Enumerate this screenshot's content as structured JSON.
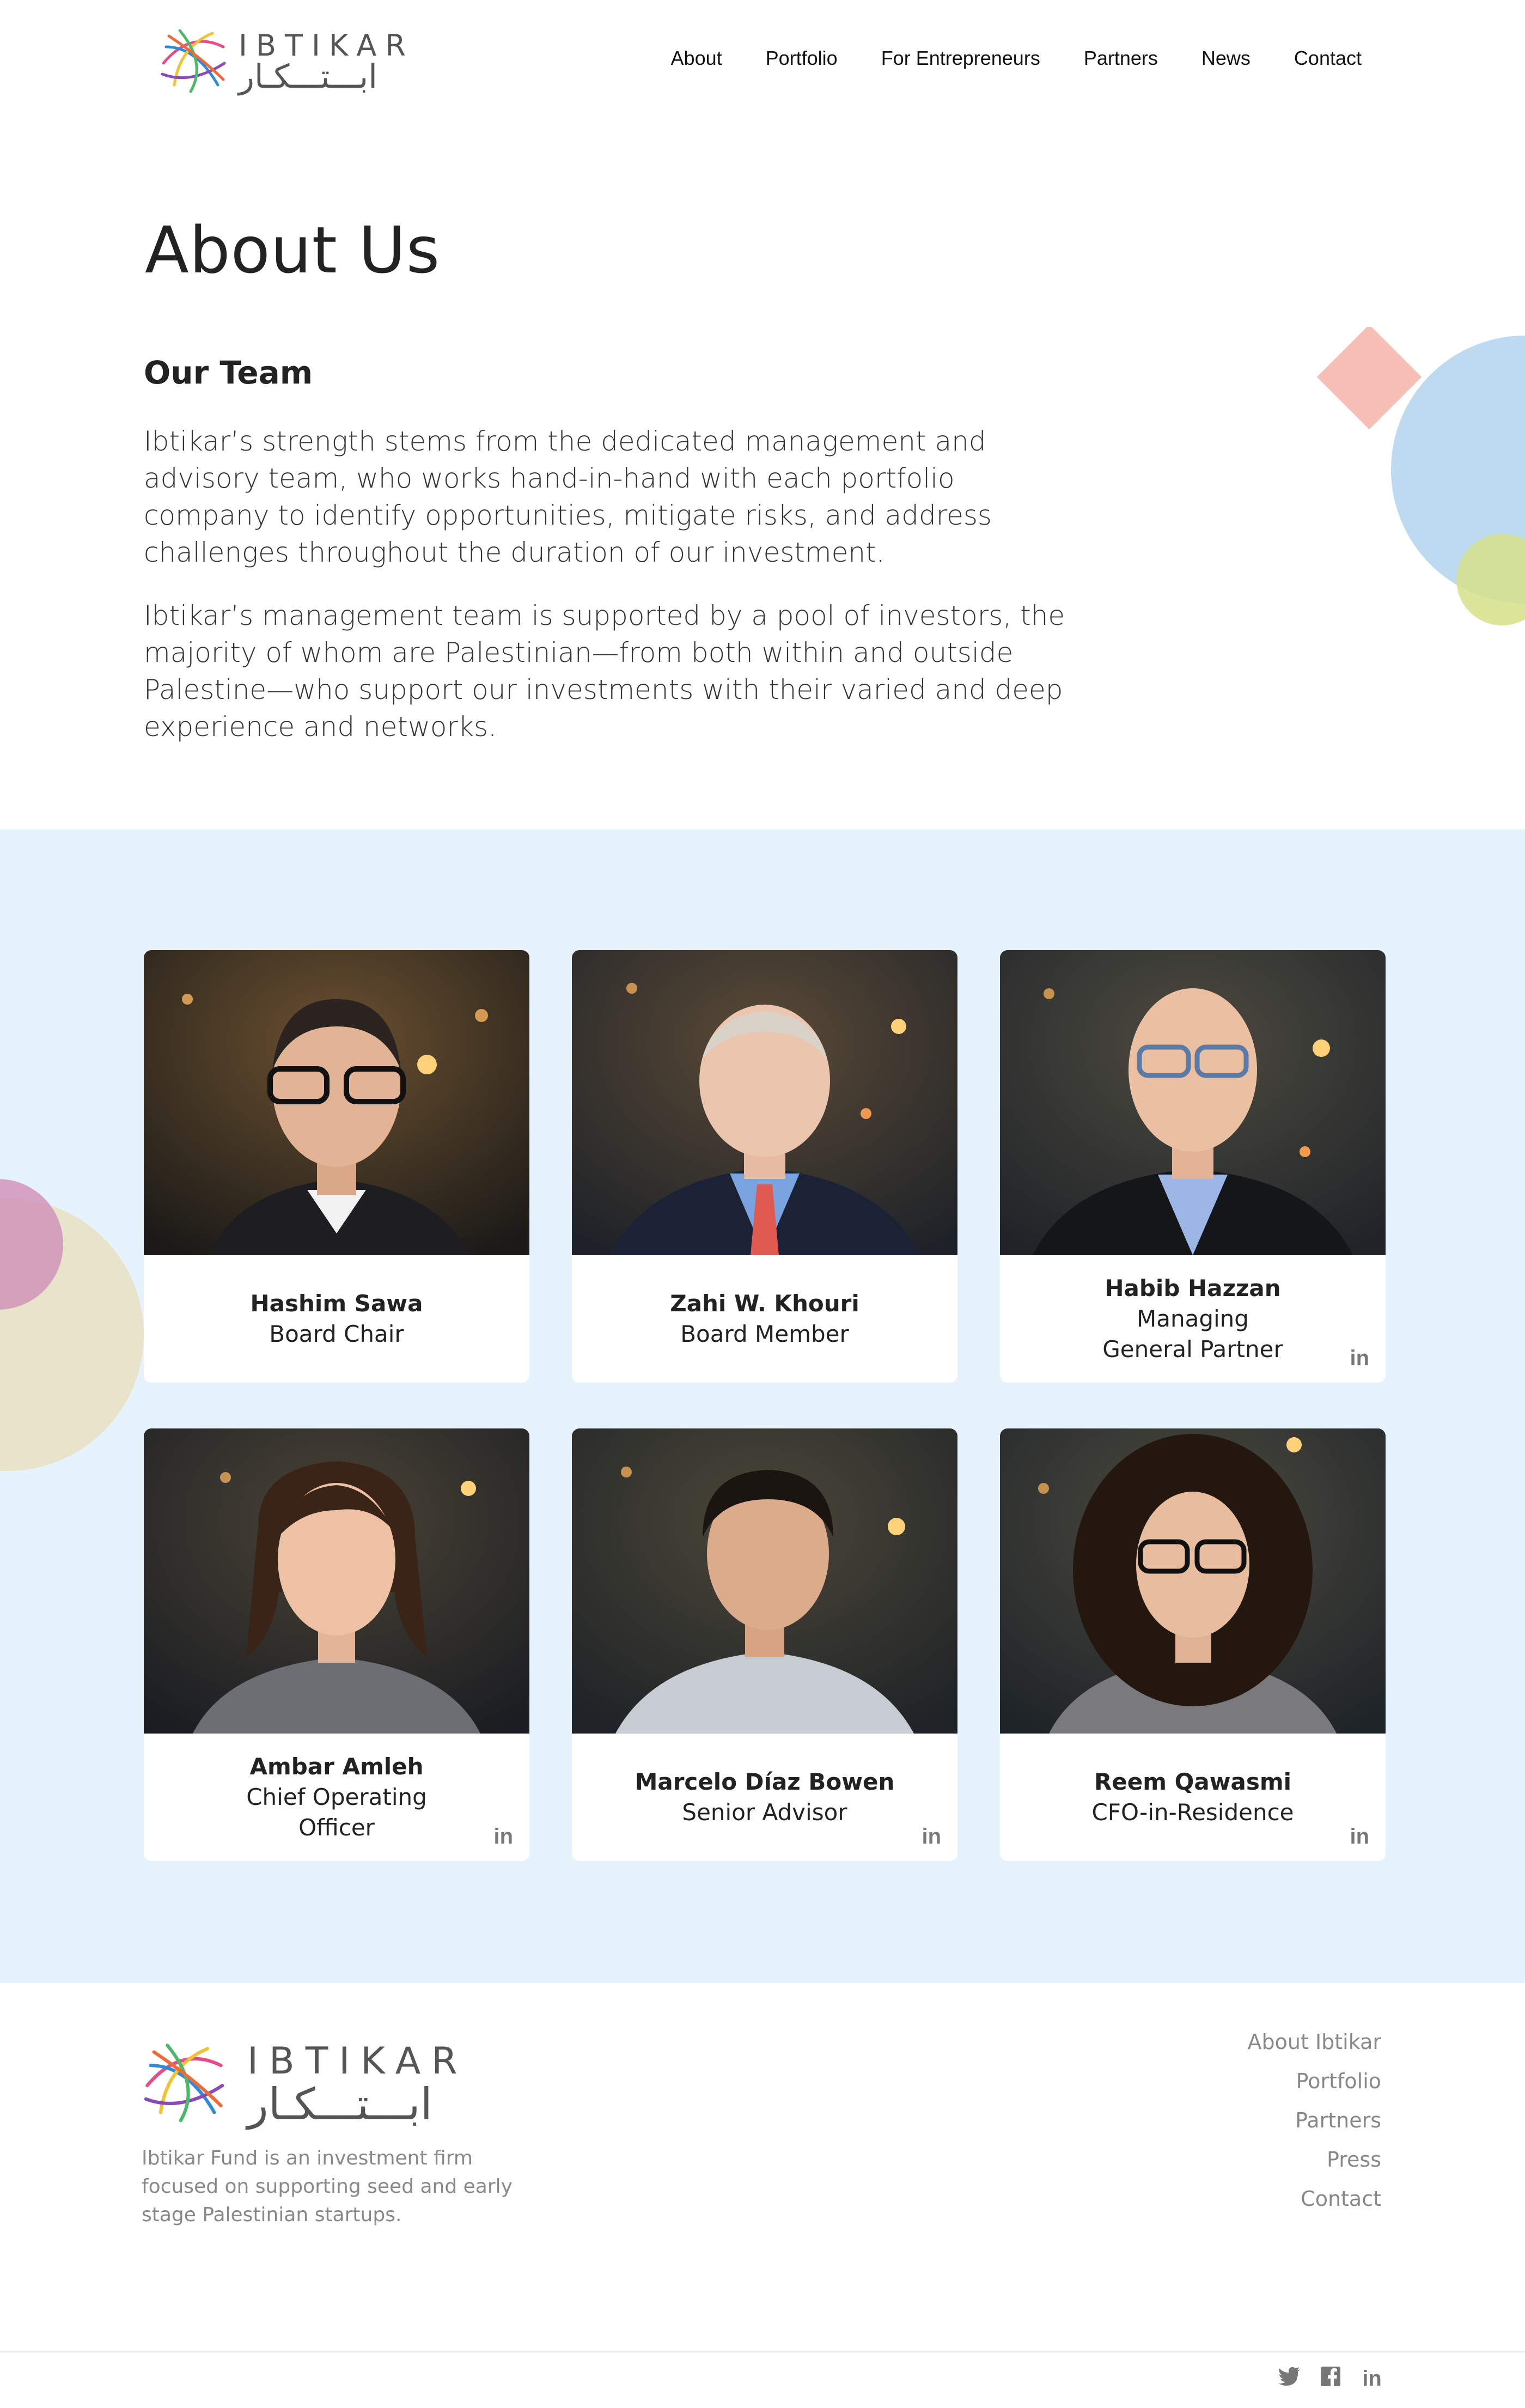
{
  "header": {
    "logo_text_en": "IBTIKAR",
    "logo_text_ar": "ابـــتـــكـار",
    "nav": [
      "About",
      "Portfolio",
      "For Entrepreneurs",
      "Partners",
      "News",
      "Contact"
    ]
  },
  "intro": {
    "title": "About Us",
    "subtitle": "Our Team",
    "paragraph1": "Ibtikar’s strength stems from the dedicated management and advisory team, who works hand-in-hand with each portfolio company to identify opportunities, mitigate risks, and address challenges throughout the duration of our investment.",
    "paragraph2": "Ibtikar’s management team is supported by a pool of investors, the majority of whom are Palestinian—from both within and outside Palestine—who support our investments with their varied and deep experience and networks."
  },
  "team": [
    {
      "name": "Hashim Sawa",
      "role": "Board Chair",
      "linkedin": false
    },
    {
      "name": "Zahi W. Khouri",
      "role": "Board Member",
      "linkedin": false
    },
    {
      "name": "Habib Hazzan",
      "role": "Managing General Partner",
      "linkedin": true
    },
    {
      "name": "Ambar Amleh",
      "role": "Chief Operating Officer",
      "linkedin": true
    },
    {
      "name": "Marcelo Díaz Bowen",
      "role": "Senior Advisor",
      "linkedin": true
    },
    {
      "name": "Reem Qawasmi",
      "role": "CFO-in-Residence",
      "linkedin": true
    }
  ],
  "icons": {
    "linkedin": "linkedin-icon",
    "twitter": "twitter-icon",
    "facebook": "facebook-icon"
  },
  "glyphs": {
    "linkedin": "in",
    "twitter": "t",
    "facebook": "f"
  },
  "footer": {
    "logo_text_en": "IBTIKAR",
    "logo_text_ar": "ابـــتـــكـار",
    "description": "Ibtikar Fund is an investment firm focused on supporting seed and early stage Palestinian startups.",
    "links": [
      "About Ibtikar",
      "Portfolio",
      "Partners",
      "Press",
      "Contact"
    ]
  },
  "colors": {
    "team_bg": "#e6f3fc",
    "text": "#222222",
    "muted": "#888888"
  }
}
